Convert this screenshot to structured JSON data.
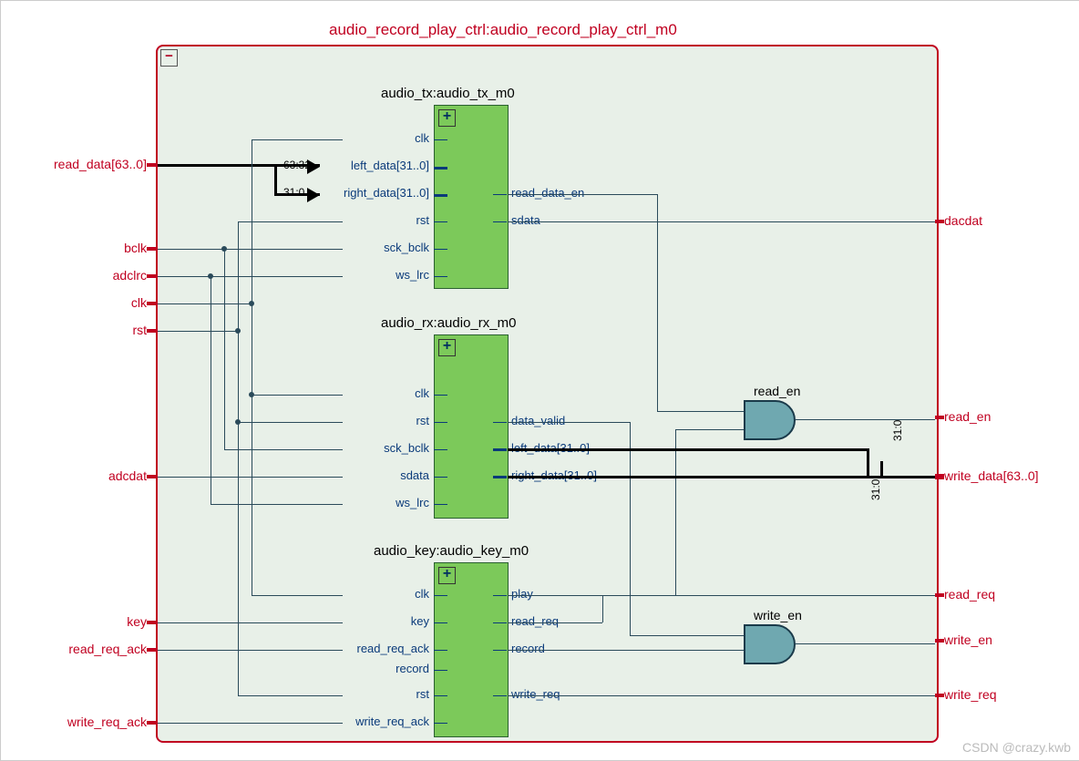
{
  "top_module": {
    "title": "audio_record_play_ctrl:audio_record_play_ctrl_m0",
    "collapse": "−"
  },
  "blocks": {
    "tx": {
      "title": "audio_tx:audio_tx_m0",
      "expand": "+",
      "inputs": [
        "clk",
        "left_data[31..0]",
        "right_data[31..0]",
        "rst",
        "sck_bclk",
        "ws_lrc"
      ],
      "outputs": [
        "read_data_en",
        "sdata"
      ],
      "bus_hi": "63:32",
      "bus_lo": "31:0"
    },
    "rx": {
      "title": "audio_rx:audio_rx_m0",
      "expand": "+",
      "inputs": [
        "clk",
        "rst",
        "sck_bclk",
        "sdata",
        "ws_lrc"
      ],
      "outputs": [
        "data_valid",
        "left_data[31..0]",
        "right_data[31..0]"
      ]
    },
    "key": {
      "title": "audio_key:audio_key_m0",
      "expand": "+",
      "inputs": [
        "clk",
        "key",
        "read_req_ack",
        "record",
        "rst",
        "write_req_ack"
      ],
      "outputs": [
        "play",
        "read_req",
        "record",
        "write_req"
      ]
    }
  },
  "ext_left": {
    "read_data": "read_data[63..0]",
    "bclk": "bclk",
    "adclrc": "adclrc",
    "clk": "clk",
    "rst": "rst",
    "adcdat": "adcdat",
    "key": "key",
    "read_req_ack": "read_req_ack",
    "write_req_ack": "write_req_ack"
  },
  "ext_right": {
    "dacdat": "dacdat",
    "read_en": "read_en",
    "write_data": "write_data[63..0]",
    "read_req": "read_req",
    "write_en": "write_en",
    "write_req": "write_req"
  },
  "gates": {
    "read_en": "read_en",
    "write_en": "write_en"
  },
  "bus_out": {
    "hi": "31:0",
    "lo": "31:0"
  },
  "watermark": "CSDN @crazy.kwb"
}
